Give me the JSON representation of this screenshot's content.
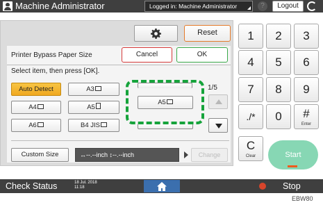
{
  "topbar": {
    "user_icon": "user-icon",
    "title": "Machine Administrator",
    "login_status": "Logged in: Machine Administrator",
    "help_icon": "?",
    "logout_label": "Logout"
  },
  "toolbar": {
    "gear_icon": "gear-icon",
    "reset_label": "Reset"
  },
  "dialog": {
    "title": "Printer Bypass Paper Size",
    "cancel_label": "Cancel",
    "ok_label": "OK",
    "instruction": "Select item, then press [OK].",
    "page_indicator": "1/5",
    "sizes": [
      {
        "label": "Auto Detect",
        "selected": true
      },
      {
        "label": "A3",
        "orientation": "landscape"
      },
      {
        "label": "A4",
        "orientation": "landscape"
      },
      {
        "label": "A5",
        "orientation": "portrait"
      },
      {
        "label": "A5",
        "orientation": "landscape"
      },
      {
        "label": "A6",
        "orientation": "landscape"
      },
      {
        "label": "B4 JIS",
        "orientation": "landscape"
      }
    ],
    "custom_size_label": "Custom Size",
    "custom_size_value": "↔--.--inch  ↕--.--inch",
    "change_label": "Change"
  },
  "keypad": {
    "keys": [
      "1",
      "2",
      "3",
      "4",
      "5",
      "6",
      "7",
      "8",
      "9",
      "./*",
      "0",
      "#"
    ],
    "enter_sub": "Enter",
    "clear_label": "C",
    "clear_sub": "Clear",
    "start_label": "Start"
  },
  "bottombar": {
    "check_status": "Check Status",
    "date": "18 Jul. 2018",
    "time": "11:18",
    "home_icon": "home-icon",
    "stop_label": "Stop"
  },
  "corner_code": "EBW80",
  "colors": {
    "bar_bg": "#3f3f3f",
    "selected": "#f0a820",
    "highlight": "#16a33b",
    "cancel_border": "#d63a3a",
    "ok_border": "#3aaa4a",
    "reset_border": "#e57a2a",
    "start": "#87d7b4",
    "home": "#3b6fae"
  }
}
